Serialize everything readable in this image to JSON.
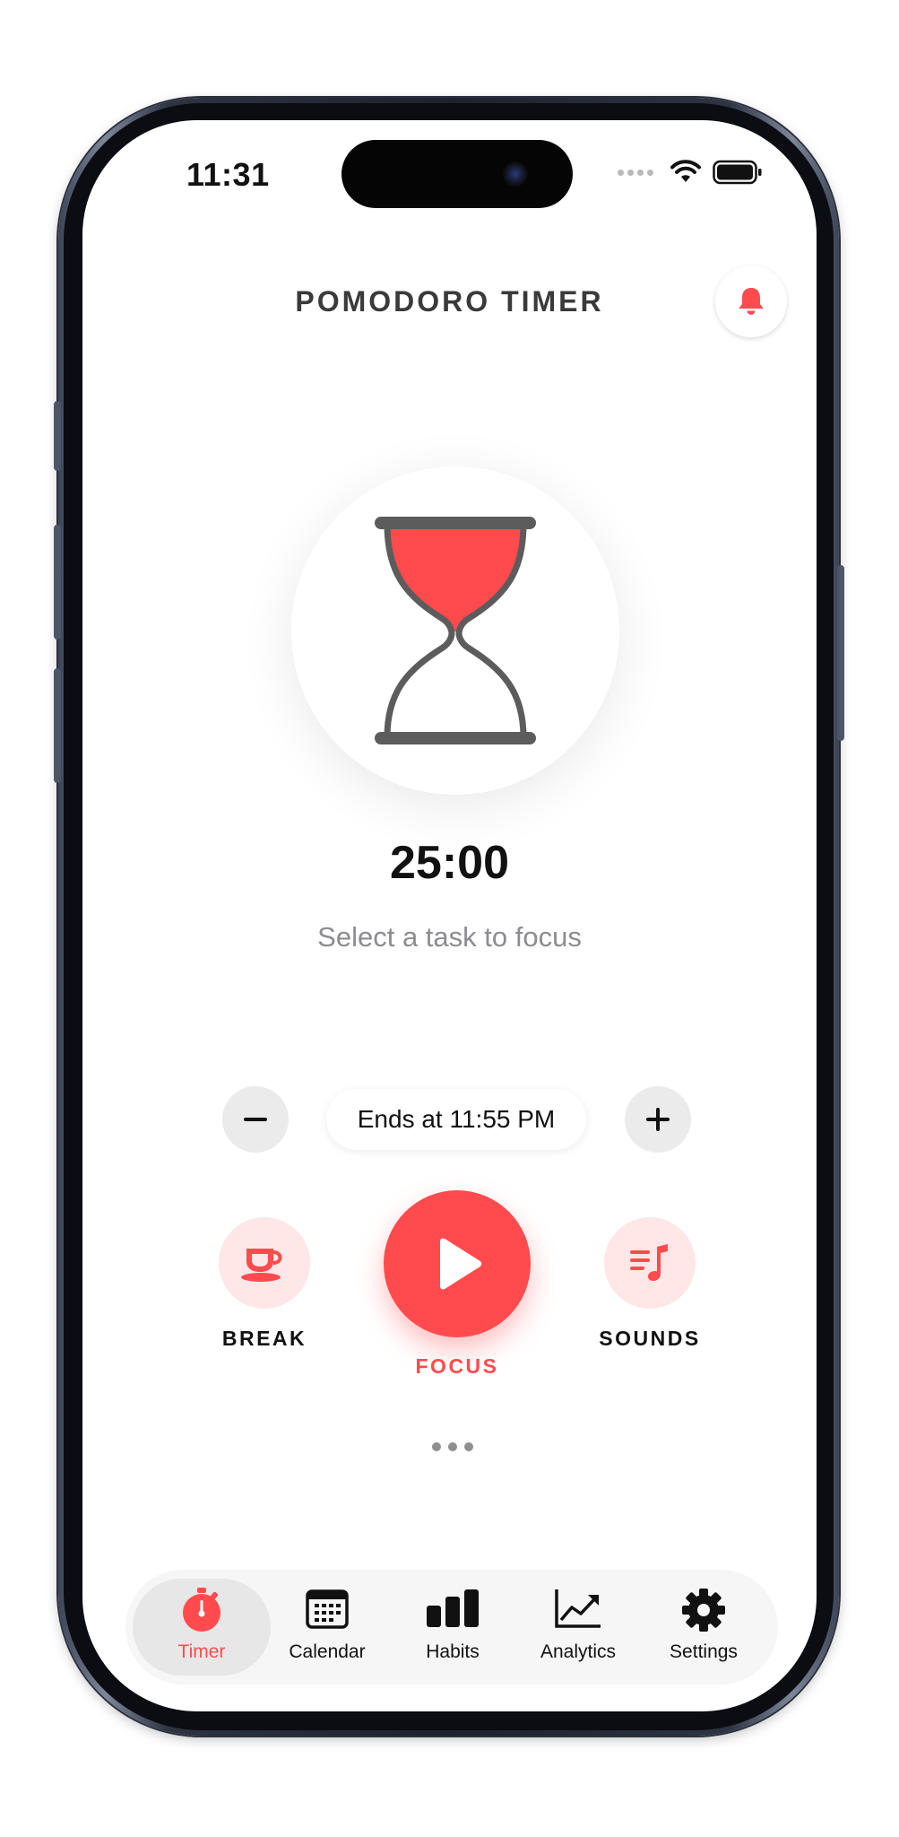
{
  "status_bar": {
    "time": "11:31"
  },
  "header": {
    "title": "POMODORO TIMER",
    "bell_icon": "bell-icon"
  },
  "timer": {
    "display": "25:00",
    "task_prompt": "Select a task to focus",
    "hourglass_fill": "#ff4b4e"
  },
  "duration_controls": {
    "ends_at": "Ends at 11:55 PM",
    "decrease_icon": "minus-icon",
    "increase_icon": "plus-icon"
  },
  "actions": {
    "break_label": "BREAK",
    "focus_label": "FOCUS",
    "sounds_label": "SOUNDS"
  },
  "tab_bar": {
    "items": [
      {
        "label": "Timer",
        "icon": "stopwatch-icon",
        "active": true
      },
      {
        "label": "Calendar",
        "icon": "calendar-icon",
        "active": false
      },
      {
        "label": "Habits",
        "icon": "bar-chart-icon",
        "active": false
      },
      {
        "label": "Analytics",
        "icon": "line-chart-icon",
        "active": false
      },
      {
        "label": "Settings",
        "icon": "gear-icon",
        "active": false
      }
    ]
  },
  "colors": {
    "accent": "#ff4b4e",
    "accent_soft": "#ffe7e7",
    "text": "#111111",
    "muted": "#8c8c91"
  }
}
